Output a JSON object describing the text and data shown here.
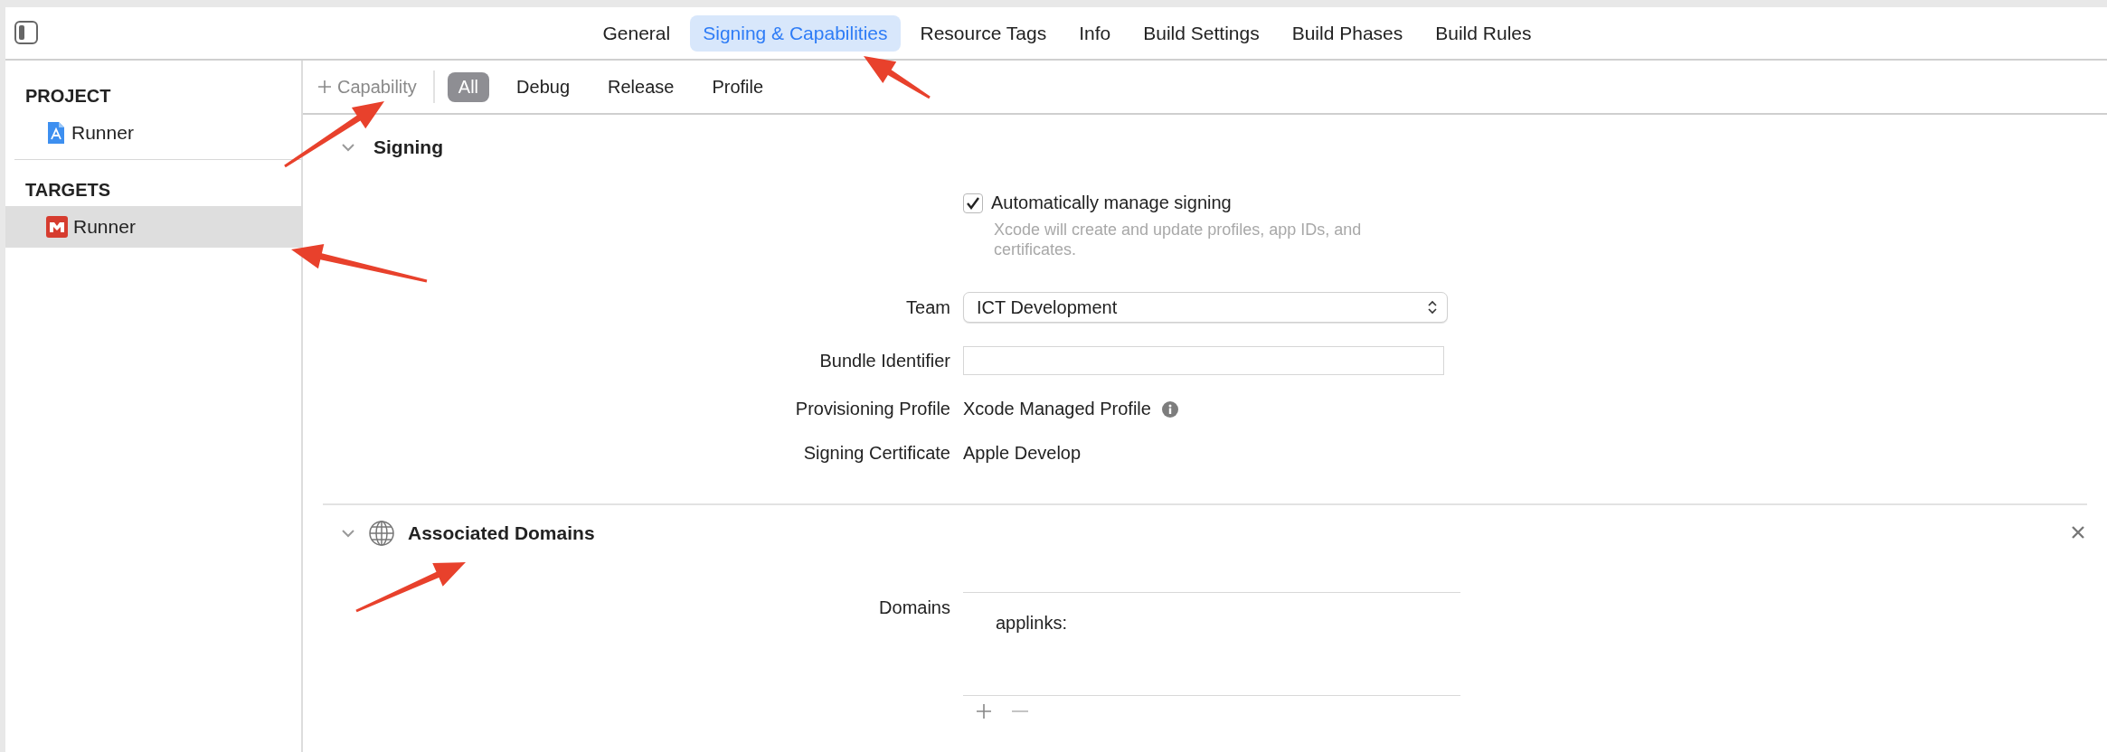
{
  "editor_tabs": [
    {
      "label": "General",
      "selected": false
    },
    {
      "label": "Signing & Capabilities",
      "selected": true
    },
    {
      "label": "Resource Tags",
      "selected": false
    },
    {
      "label": "Info",
      "selected": false
    },
    {
      "label": "Build Settings",
      "selected": false
    },
    {
      "label": "Build Phases",
      "selected": false
    },
    {
      "label": "Build Rules",
      "selected": false
    }
  ],
  "sidebar": {
    "sections": [
      {
        "heading": "PROJECT",
        "items": [
          {
            "label": "Runner",
            "kind": "project",
            "selected": false
          }
        ]
      },
      {
        "heading": "TARGETS",
        "items": [
          {
            "label": "Runner",
            "kind": "target",
            "selected": true
          }
        ]
      }
    ]
  },
  "toolbar": {
    "add_label": "Capability",
    "filters": [
      {
        "label": "All",
        "selected": true
      },
      {
        "label": "Debug",
        "selected": false
      },
      {
        "label": "Release",
        "selected": false
      },
      {
        "label": "Profile",
        "selected": false
      }
    ]
  },
  "signing": {
    "title": "Signing",
    "expanded": true,
    "auto_manage": {
      "label": "Automatically manage signing",
      "checked": true,
      "hint": "Xcode will create and update profiles, app IDs, and certificates."
    },
    "fields": [
      {
        "label": "Team",
        "kind": "popup",
        "value": "ICT Development"
      },
      {
        "label": "Bundle Identifier",
        "kind": "text"
      },
      {
        "label": "Provisioning Profile",
        "kind": "static",
        "value": "Xcode Managed Profile",
        "info": true
      },
      {
        "label": "Signing Certificate",
        "kind": "static",
        "value": "Apple Develop"
      }
    ]
  },
  "associated_domains": {
    "title": "Associated Domains",
    "expanded": true,
    "domains_label": "Domains",
    "domains": [
      "applinks:"
    ]
  }
}
